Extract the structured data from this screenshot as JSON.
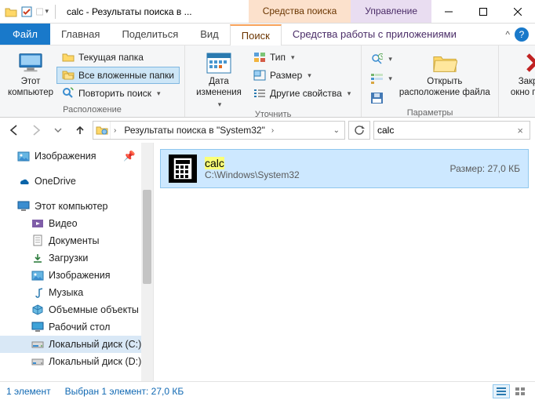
{
  "window": {
    "title": "calc - Результаты поиска в ...",
    "ctx_search": "Средства поиска",
    "ctx_manage": "Управление"
  },
  "tabs": {
    "file": "Файл",
    "home": "Главная",
    "share": "Поделиться",
    "view": "Вид",
    "search": "Поиск",
    "apptools": "Средства работы с приложениями"
  },
  "ribbon": {
    "location": {
      "this_pc": "Этот\nкомпьютер",
      "current_folder": "Текущая папка",
      "all_subfolders": "Все вложенные папки",
      "search_again": "Повторить поиск",
      "group_label": "Расположение"
    },
    "refine": {
      "date_modified": "Дата\nизменения",
      "type": "Тип",
      "size": "Размер",
      "other_props": "Другие свойства",
      "group_label": "Уточнить"
    },
    "options": {
      "open_location": "Открыть\nрасположение файла",
      "group_label": "Параметры"
    },
    "close": {
      "close_search": "Закрыть\nокно поиска"
    }
  },
  "breadcrumb": {
    "text": "Результаты поиска в \"System32\"",
    "search_value": "calc"
  },
  "tree": {
    "pictures_quick": "Изображения",
    "onedrive": "OneDrive",
    "this_pc": "Этот компьютер",
    "videos": "Видео",
    "documents": "Документы",
    "downloads": "Загрузки",
    "pictures": "Изображения",
    "music": "Музыка",
    "objects3d": "Объемные объекты",
    "desktop": "Рабочий стол",
    "drive_c": "Локальный диск (C:)",
    "drive_d": "Локальный диск (D:)"
  },
  "result": {
    "name": "calc",
    "path": "C:\\Windows\\System32",
    "size_label": "Размер:",
    "size_value": "27,0 КБ"
  },
  "status": {
    "count": "1 элемент",
    "selection": "Выбран 1 элемент: 27,0 КБ"
  }
}
